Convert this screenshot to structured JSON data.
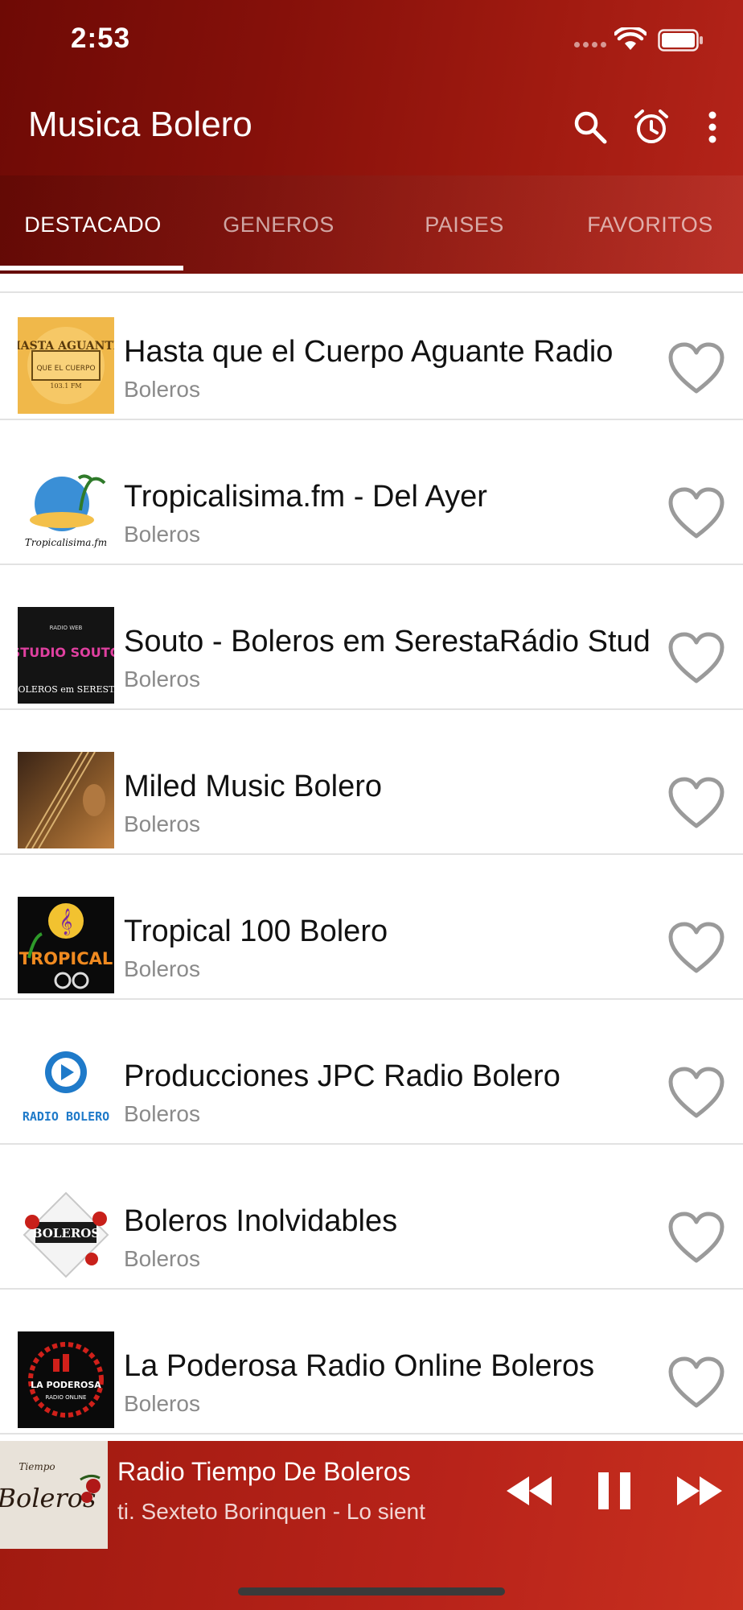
{
  "status_bar": {
    "time": "2:53",
    "icons": [
      "cellular-dots-icon",
      "wifi-icon",
      "battery-icon"
    ]
  },
  "header": {
    "title": "Musica Bolero",
    "actions": [
      "search-icon",
      "alarm-icon",
      "more-vertical-icon"
    ]
  },
  "tabs": {
    "items": [
      "DESTACADO",
      "GENEROS",
      "PAISES",
      "FAVORITOS"
    ],
    "active_index": 0
  },
  "stations": [
    {
      "title": "Hasta que el Cuerpo Aguante Radio",
      "genre": "Boleros",
      "logo_text": "HASTA AGUANTE"
    },
    {
      "title": "Tropicalisima.fm - Del Ayer",
      "genre": "Boleros",
      "logo_text": "Tropicalisima.fm"
    },
    {
      "title": " Souto - Boleros em SerestaRádio Stud",
      "genre": "Boleros",
      "logo_text": "STUDIO SOUTO"
    },
    {
      "title": "Miled Music Bolero",
      "genre": "Boleros",
      "logo_text": ""
    },
    {
      "title": "Tropical 100 Bolero",
      "genre": "Boleros",
      "logo_text": "TROPICAL"
    },
    {
      "title": "Producciones JPC Radio Bolero",
      "genre": "Boleros",
      "logo_text": "RADIO BOLERO"
    },
    {
      "title": "Boleros Inolvidables",
      "genre": "Boleros",
      "logo_text": "BOLEROS"
    },
    {
      "title": "La Poderosa Radio Online Boleros",
      "genre": "Boleros",
      "logo_text": "LA PODEROSA"
    }
  ],
  "player": {
    "station": "Radio Tiempo De Boleros",
    "track": "ti.   Sexteto Borinquen - Lo sient",
    "logo_text": "Boleros",
    "controls": [
      "rewind-icon",
      "pause-icon",
      "fast-forward-icon"
    ]
  },
  "colors": {
    "header_dark": "#6e0a05",
    "header_light": "#b5241a",
    "player_red": "#c8301f",
    "heart_gray": "#9a9a9a",
    "divider": "#e2e2e2"
  }
}
